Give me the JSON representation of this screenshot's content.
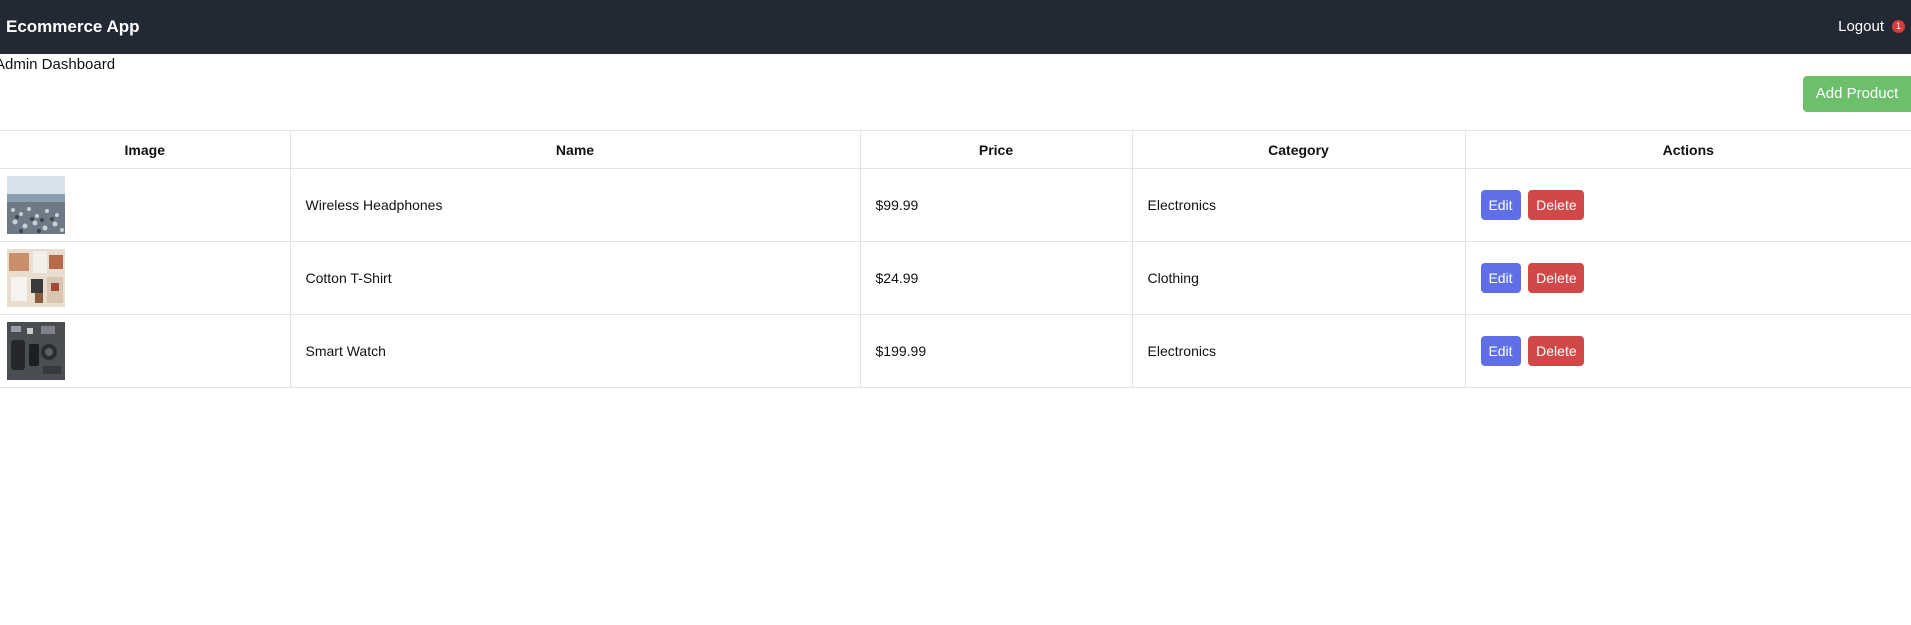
{
  "navbar": {
    "brand": "Ecommerce App",
    "logout_label": "Logout",
    "notification_count": "1"
  },
  "page": {
    "title": "Admin Dashboard",
    "add_product_label": "Add Product"
  },
  "table": {
    "headers": {
      "image": "Image",
      "name": "Name",
      "price": "Price",
      "category": "Category",
      "actions": "Actions"
    },
    "rows": [
      {
        "name": "Wireless Headphones",
        "price": "$99.99",
        "category": "Electronics",
        "edit_label": "Edit",
        "delete_label": "Delete",
        "image": "beach-pebbles-image"
      },
      {
        "name": "Cotton T-Shirt",
        "price": "$24.99",
        "category": "Clothing",
        "edit_label": "Edit",
        "delete_label": "Delete",
        "image": "flatlay-items-image"
      },
      {
        "name": "Smart Watch",
        "price": "$199.99",
        "category": "Electronics",
        "edit_label": "Edit",
        "delete_label": "Delete",
        "image": "dark-gadgets-image"
      }
    ]
  },
  "colors": {
    "navbar_bg": "#222834",
    "add_button": "#6cc06b",
    "edit_button": "#5f6fe6",
    "delete_button": "#d04848",
    "badge": "#d93a3a"
  }
}
